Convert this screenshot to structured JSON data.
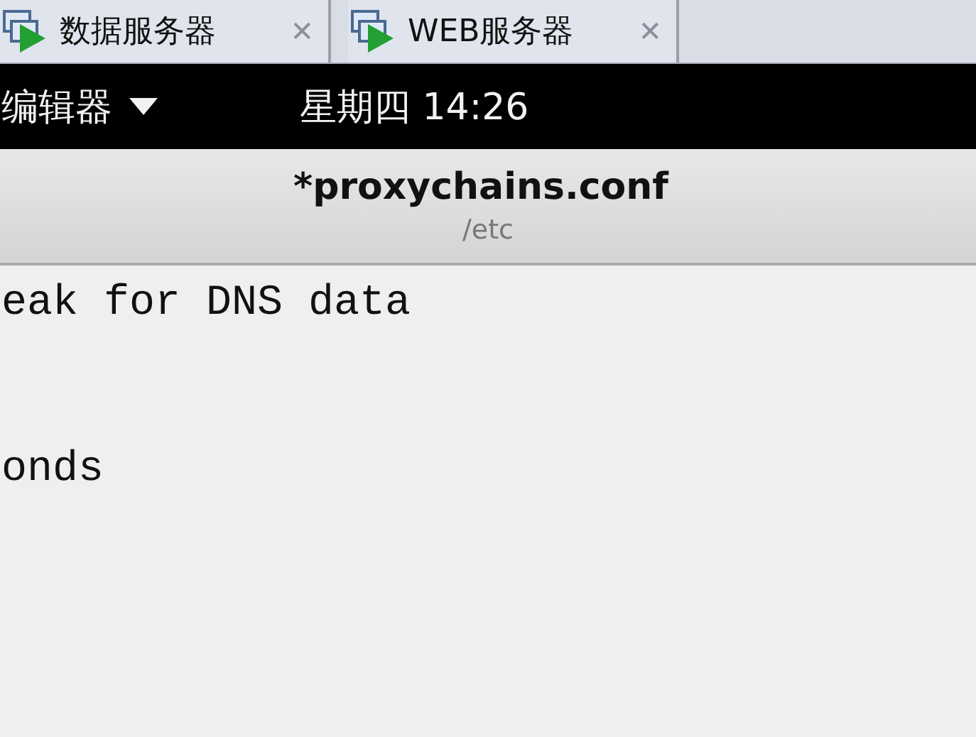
{
  "tabs": [
    {
      "label": "数据服务器",
      "close": "✕"
    },
    {
      "label": "WEB服务器",
      "close": "✕"
    }
  ],
  "top_bar": {
    "app_menu": "编辑器",
    "clock": "星期四 14:26"
  },
  "header": {
    "title": "*proxychains.conf",
    "subtitle": "/etc"
  },
  "editor": {
    "lines": [
      {
        "kind": "text",
        "text": "eak for DNS data"
      },
      {
        "kind": "blank"
      },
      {
        "kind": "blank"
      },
      {
        "kind": "text",
        "text": "onds"
      }
    ]
  }
}
